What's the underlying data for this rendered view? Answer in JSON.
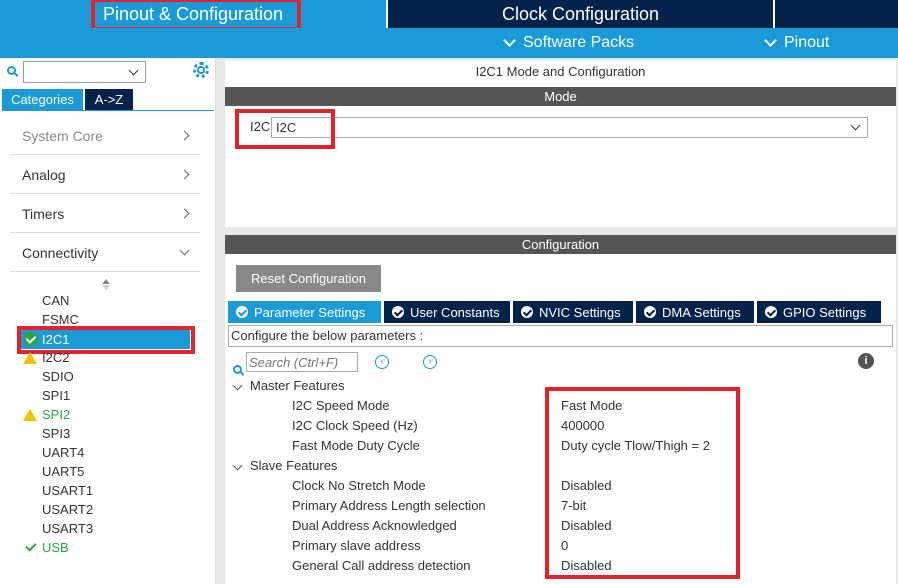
{
  "top_tabs": {
    "pinout": "Pinout & Configuration",
    "clock": "Clock Configuration"
  },
  "subbar": {
    "software_packs": "Software Packs",
    "pinout": "Pinout"
  },
  "left": {
    "tabs": {
      "categories": "Categories",
      "az": "A->Z"
    },
    "categories": [
      "System Core",
      "Analog",
      "Timers",
      "Connectivity"
    ],
    "peripherals": [
      "CAN",
      "FSMC",
      "I2C1",
      "I2C2",
      "SDIO",
      "SPI1",
      "SPI2",
      "SPI3",
      "UART4",
      "UART5",
      "USART1",
      "USART2",
      "USART3",
      "USB"
    ]
  },
  "right": {
    "title": "I2C1 Mode and Configuration",
    "mode_header": "Mode",
    "mode_label": "I2C",
    "mode_value": "I2C",
    "config_header": "Configuration",
    "reset_button": "Reset Configuration",
    "tabs": [
      "Parameter Settings",
      "User Constants",
      "NVIC Settings",
      "DMA Settings",
      "GPIO Settings"
    ],
    "configure_text": "Configure the below parameters :",
    "search_placeholder": "Search (Ctrl+F)",
    "groups": {
      "master": "Master Features",
      "slave": "Slave Features"
    },
    "master_params": [
      {
        "name": "I2C Speed Mode",
        "value": "Fast Mode"
      },
      {
        "name": "I2C Clock Speed (Hz)",
        "value": "400000"
      },
      {
        "name": "Fast Mode Duty Cycle",
        "value": "Duty cycle Tlow/Thigh = 2"
      }
    ],
    "slave_params": [
      {
        "name": "Clock No Stretch Mode",
        "value": "Disabled"
      },
      {
        "name": "Primary Address Length selection",
        "value": "7-bit"
      },
      {
        "name": "Dual Address Acknowledged",
        "value": "Disabled"
      },
      {
        "name": "Primary slave address",
        "value": "0"
      },
      {
        "name": "General Call address detection",
        "value": "Disabled"
      }
    ]
  },
  "colors": {
    "accent": "#1a9bd7",
    "dark": "#03234b",
    "highlight": "#e3232b",
    "ok": "#2aa63b",
    "warn": "#f2c200"
  }
}
